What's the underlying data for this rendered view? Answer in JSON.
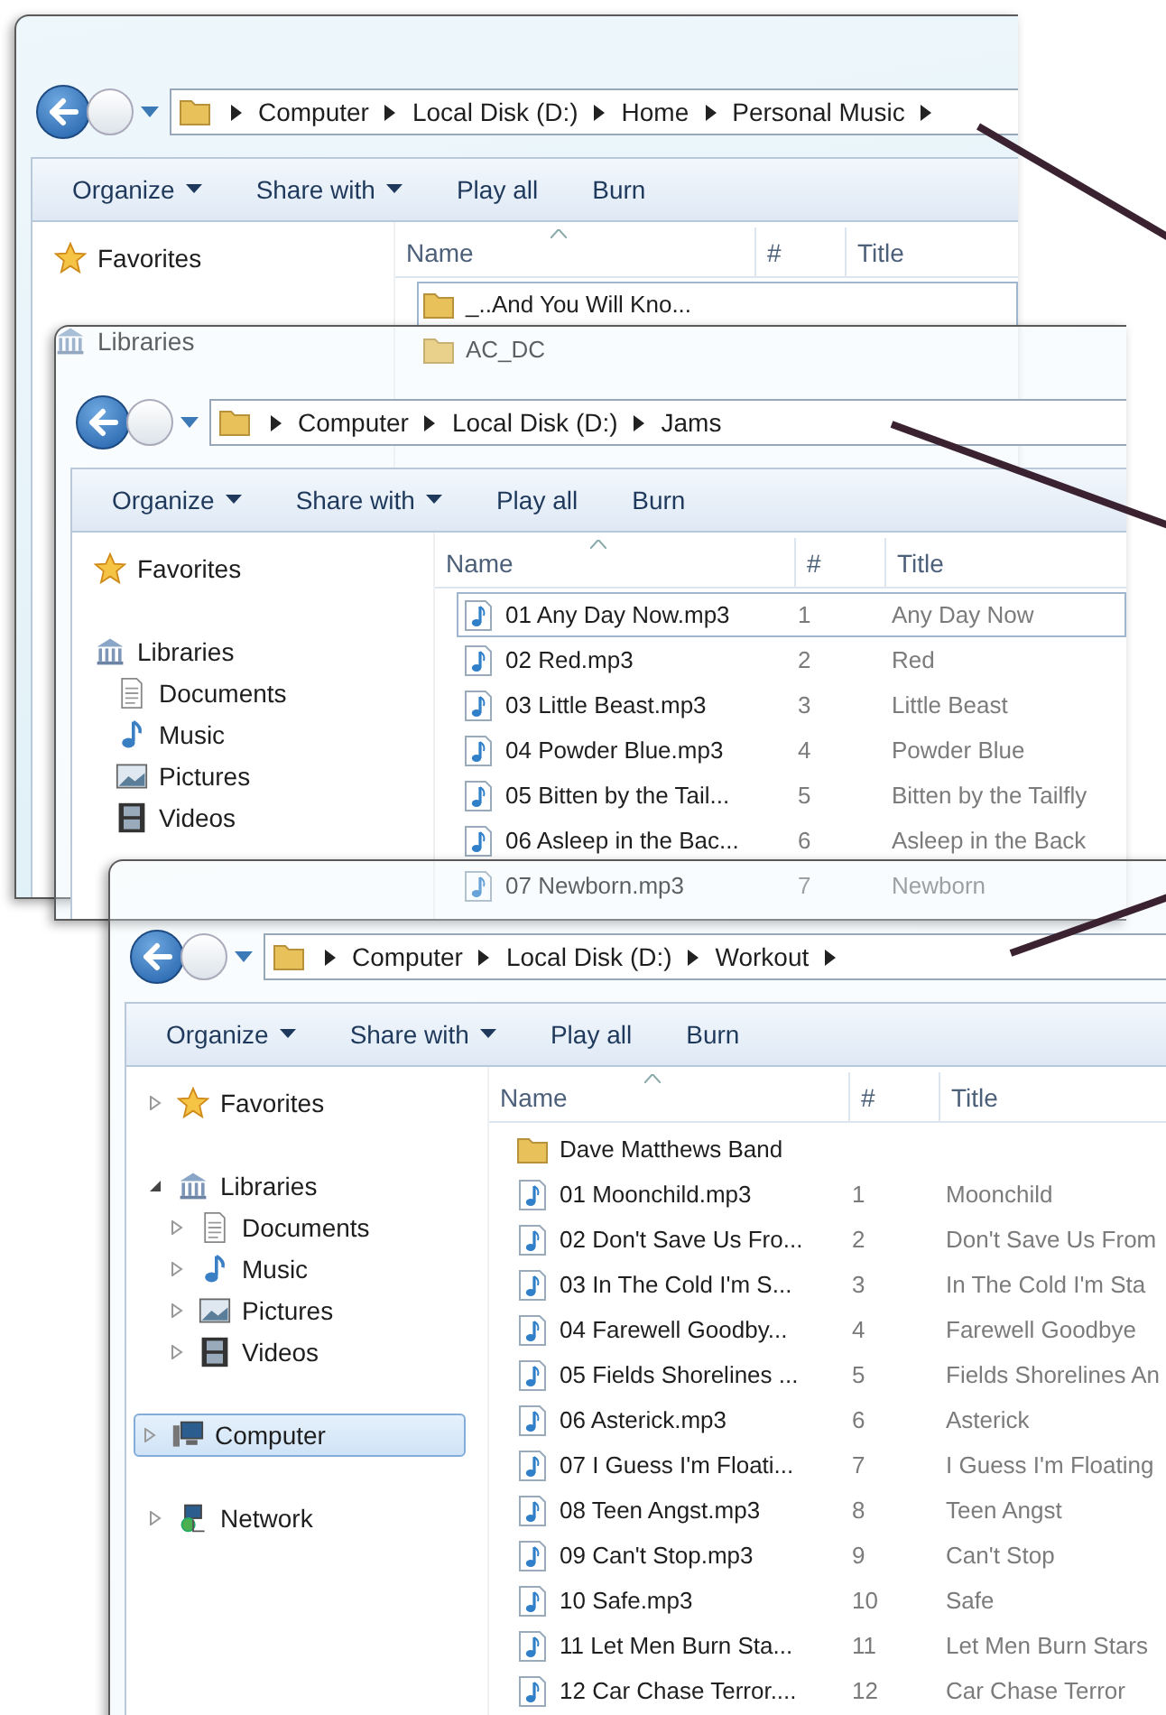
{
  "windows": [
    {
      "has_subfolders": true,
      "breadcrumb": [
        "Computer",
        "Local Disk (D:)",
        "Home",
        "Personal Music"
      ],
      "toolbar": [
        {
          "label": "Organize",
          "kind": "menu"
        },
        {
          "label": "Share with",
          "kind": "menu"
        },
        {
          "label": "Play all",
          "kind": "action"
        },
        {
          "label": "Burn",
          "kind": "action"
        }
      ],
      "columns": [
        "Name",
        "#",
        "Title"
      ],
      "sidebar": [
        {
          "label": "Favorites",
          "kind": "star"
        },
        {
          "label": "Libraries",
          "kind": "library"
        }
      ],
      "files": [
        {
          "name": "_..And You Will Kno...",
          "kind": "folder",
          "selected": true
        },
        {
          "name": "AC_DC",
          "kind": "folder",
          "selected": false
        }
      ]
    },
    {
      "has_subfolders": false,
      "breadcrumb": [
        "Computer",
        "Local Disk (D:)",
        "Jams"
      ],
      "toolbar": [
        {
          "label": "Organize",
          "kind": "menu"
        },
        {
          "label": "Share with",
          "kind": "menu"
        },
        {
          "label": "Play all",
          "kind": "action"
        },
        {
          "label": "Burn",
          "kind": "action"
        }
      ],
      "columns": [
        "Name",
        "#",
        "Title"
      ],
      "sidebar": [
        {
          "label": "Favorites",
          "kind": "star"
        },
        {
          "label": "Libraries",
          "kind": "library",
          "children": [
            {
              "label": "Documents",
              "kind": "document"
            },
            {
              "label": "Music",
              "kind": "music"
            },
            {
              "label": "Pictures",
              "kind": "pictures"
            },
            {
              "label": "Videos",
              "kind": "videos"
            }
          ]
        }
      ],
      "files": [
        {
          "name": "01 Any Day Now.mp3",
          "number": "1",
          "title": "Any Day Now",
          "kind": "audio",
          "selected": true
        },
        {
          "name": "02 Red.mp3",
          "number": "2",
          "title": "Red",
          "kind": "audio",
          "selected": false
        },
        {
          "name": "03 Little Beast.mp3",
          "number": "3",
          "title": "Little Beast",
          "kind": "audio",
          "selected": false
        },
        {
          "name": "04 Powder Blue.mp3",
          "number": "4",
          "title": "Powder Blue",
          "kind": "audio",
          "selected": false
        },
        {
          "name": "05 Bitten by the Tail...",
          "number": "5",
          "title": "Bitten by the Tailfly",
          "kind": "audio",
          "selected": false
        },
        {
          "name": "06 Asleep in the Bac...",
          "number": "6",
          "title": "Asleep in the Back",
          "kind": "audio",
          "selected": false
        },
        {
          "name": "07 Newborn.mp3",
          "number": "7",
          "title": "Newborn",
          "kind": "audio",
          "selected": false
        }
      ]
    },
    {
      "has_subfolders": true,
      "breadcrumb": [
        "Computer",
        "Local Disk (D:)",
        "Workout"
      ],
      "toolbar": [
        {
          "label": "Organize",
          "kind": "menu"
        },
        {
          "label": "Share with",
          "kind": "menu"
        },
        {
          "label": "Play all",
          "kind": "action"
        },
        {
          "label": "Burn",
          "kind": "action"
        }
      ],
      "columns": [
        "Name",
        "#",
        "Title"
      ],
      "sidebar": [
        {
          "label": "Favorites",
          "kind": "star",
          "expanded": false,
          "selected": false
        },
        {
          "label": "Libraries",
          "kind": "library",
          "expanded": true,
          "selected": false,
          "children": [
            {
              "label": "Documents",
              "kind": "document",
              "expanded": false,
              "selected": false
            },
            {
              "label": "Music",
              "kind": "music",
              "expanded": false,
              "selected": false
            },
            {
              "label": "Pictures",
              "kind": "pictures",
              "expanded": false,
              "selected": false
            },
            {
              "label": "Videos",
              "kind": "videos",
              "expanded": false,
              "selected": false
            }
          ]
        },
        {
          "label": "Computer",
          "kind": "computer",
          "expanded": false,
          "selected": true
        },
        {
          "label": "Network",
          "kind": "network",
          "expanded": false,
          "selected": false
        }
      ],
      "files": [
        {
          "name": "Dave Matthews Band",
          "kind": "folder",
          "selected": false
        },
        {
          "name": "01 Moonchild.mp3",
          "number": "1",
          "title": "Moonchild",
          "kind": "audio",
          "selected": false
        },
        {
          "name": "02 Don't Save Us Fro...",
          "number": "2",
          "title": "Don't Save Us From",
          "kind": "audio",
          "selected": false
        },
        {
          "name": "03 In The Cold I'm S...",
          "number": "3",
          "title": "In The Cold I'm Sta",
          "kind": "audio",
          "selected": false
        },
        {
          "name": "04 Farewell Goodby...",
          "number": "4",
          "title": "Farewell Goodbye",
          "kind": "audio",
          "selected": false
        },
        {
          "name": "05 Fields Shorelines ...",
          "number": "5",
          "title": "Fields Shorelines An",
          "kind": "audio",
          "selected": false
        },
        {
          "name": "06 Asterick.mp3",
          "number": "6",
          "title": "Asterick",
          "kind": "audio",
          "selected": false
        },
        {
          "name": "07 I Guess I'm Floati...",
          "number": "7",
          "title": "I Guess I'm Floating",
          "kind": "audio",
          "selected": false
        },
        {
          "name": "08 Teen Angst.mp3",
          "number": "8",
          "title": "Teen Angst",
          "kind": "audio",
          "selected": false
        },
        {
          "name": "09 Can't Stop.mp3",
          "number": "9",
          "title": "Can't Stop",
          "kind": "audio",
          "selected": false
        },
        {
          "name": "10 Safe.mp3",
          "number": "10",
          "title": "Safe",
          "kind": "audio",
          "selected": false
        },
        {
          "name": "11 Let Men Burn Sta...",
          "number": "11",
          "title": "Let Men Burn Stars",
          "kind": "audio",
          "selected": false
        },
        {
          "name": "12 Car Chase Terror....",
          "number": "12",
          "title": "Car Chase Terror",
          "kind": "audio",
          "selected": false
        }
      ]
    }
  ]
}
